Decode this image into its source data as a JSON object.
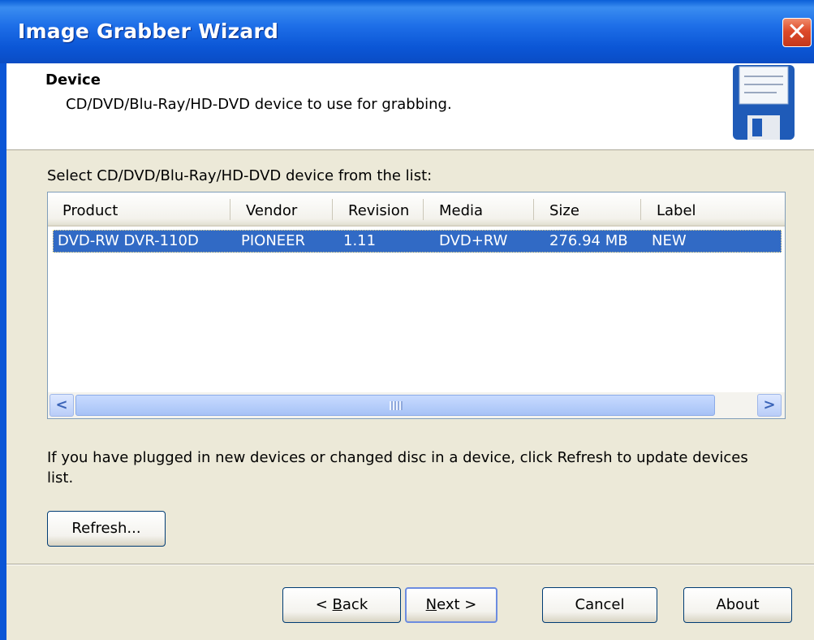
{
  "window": {
    "title": "Image Grabber Wizard",
    "close_glyph": "✕"
  },
  "header": {
    "title": "Device",
    "subtitle": "CD/DVD/Blu-Ray/HD-DVD device to use for grabbing.",
    "icon": "floppy-disk-icon"
  },
  "device_list": {
    "label": "Select CD/DVD/Blu-Ray/HD-DVD device from the list:",
    "columns": [
      "Product",
      "Vendor",
      "Revision",
      "Media",
      "Size",
      "Label"
    ],
    "rows": [
      {
        "product": "DVD-RW  DVR-110D",
        "vendor": "PIONEER",
        "revision": "1.11",
        "media": "DVD+RW",
        "size": "276.94 MB",
        "label": "NEW",
        "selected": true
      }
    ],
    "scroll_left_glyph": "<",
    "scroll_right_glyph": ">"
  },
  "info_text": "If you have plugged in new devices or changed disc in a device, click Refresh to update devices list.",
  "buttons": {
    "refresh": "Refresh...",
    "back_mnemonic": "B",
    "back_prefix": "< ",
    "back_rest": "ack",
    "next_mnemonic": "N",
    "next_rest": "ext >",
    "cancel": "Cancel",
    "about": "About"
  },
  "colors": {
    "titlebar": "#0B56D6",
    "selection": "#316AC5",
    "dialog_bg": "#ECE9D8"
  }
}
